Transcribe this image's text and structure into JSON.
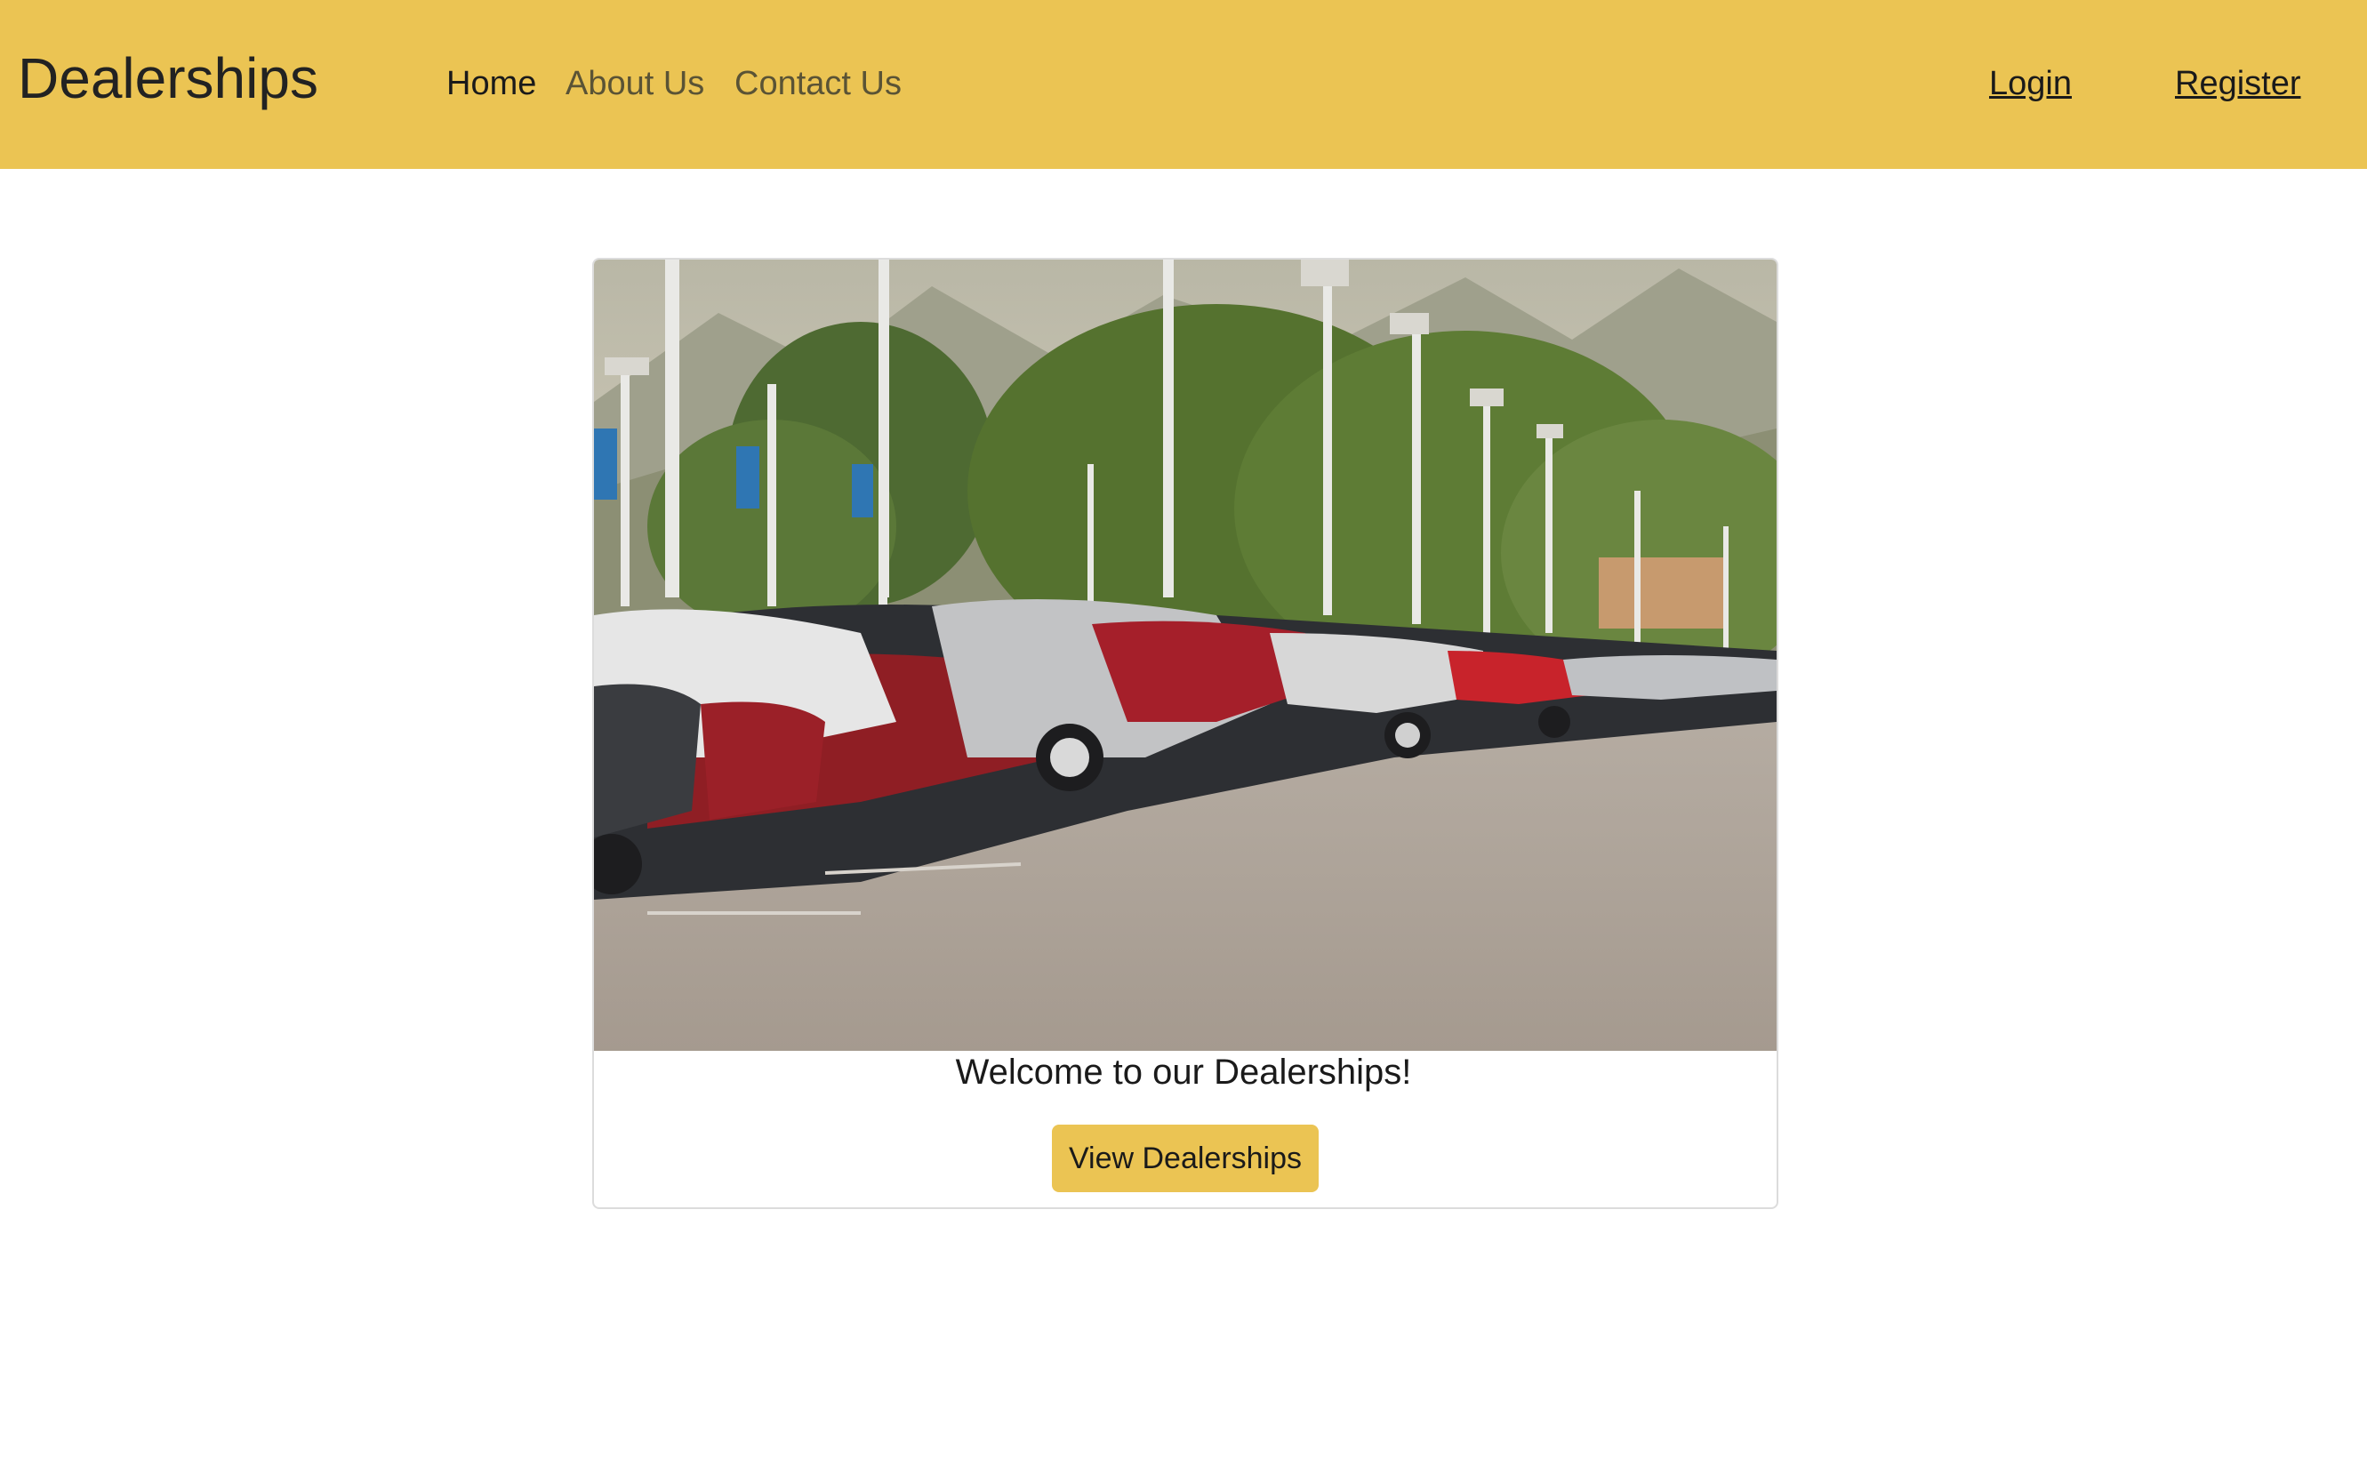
{
  "navbar": {
    "brand": "Dealerships",
    "links": [
      {
        "label": "Home",
        "active": true
      },
      {
        "label": "About Us",
        "active": false
      },
      {
        "label": "Contact Us",
        "active": false
      }
    ],
    "login_label": "Login",
    "register_label": "Register"
  },
  "card": {
    "title": "Welcome to our Dealerships!",
    "button_label": "View Dealerships",
    "image_name": "car-lot-photo"
  },
  "colors": {
    "accent": "#ebc453",
    "text": "#1a1a1a",
    "nav_inactive": "#5a5335"
  }
}
